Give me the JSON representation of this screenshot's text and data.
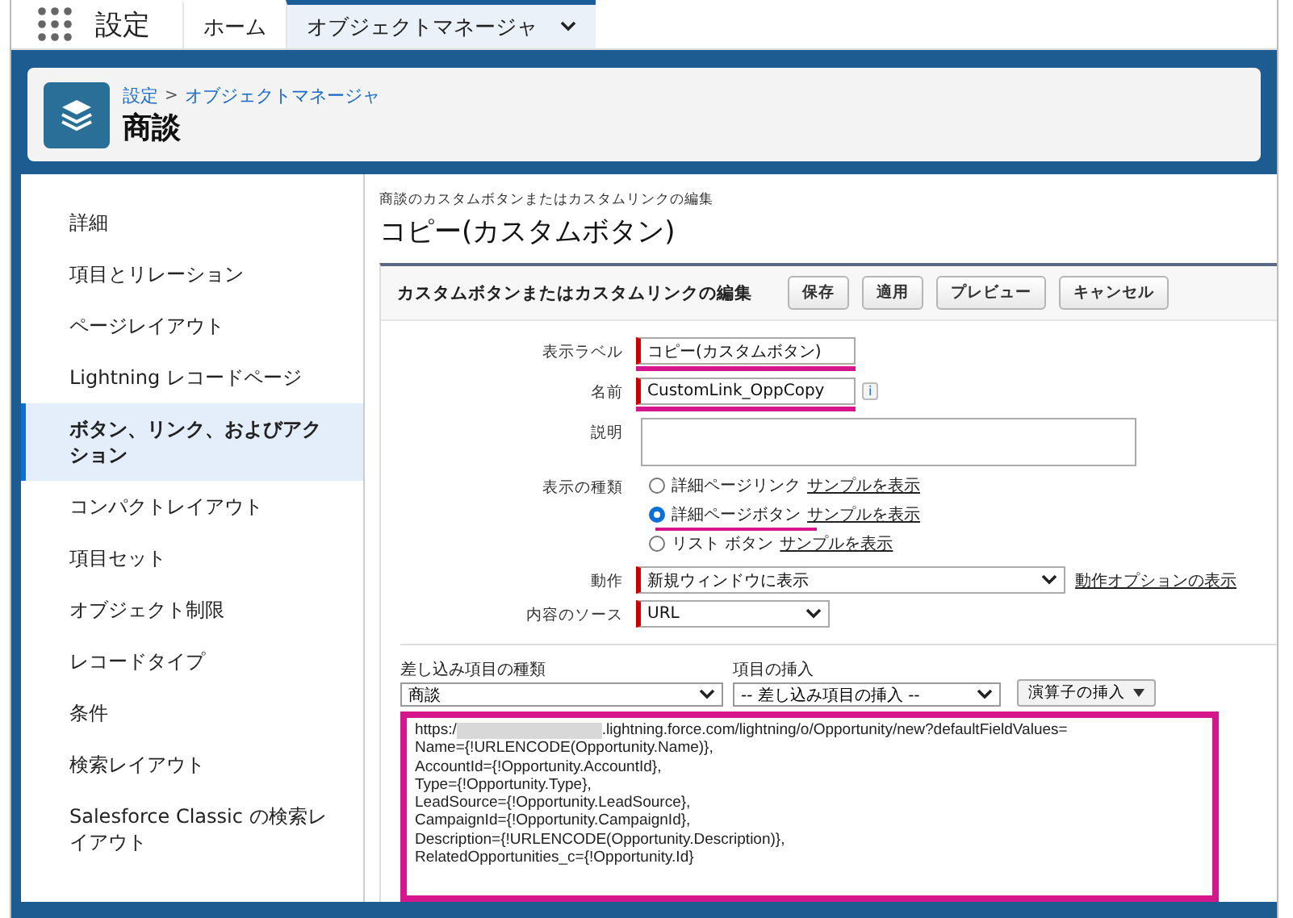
{
  "nav": {
    "app_title": "設定",
    "tabs": [
      {
        "label": "ホーム",
        "selected": false,
        "menu": false
      },
      {
        "label": "オブジェクトマネージャ",
        "selected": true,
        "menu": true
      }
    ]
  },
  "header": {
    "breadcrumb": [
      {
        "label": "設定"
      },
      {
        "label": "オブジェクトマネージャ"
      }
    ],
    "separator": ">",
    "title": "商談"
  },
  "sidebar": {
    "items": [
      {
        "label": "詳細",
        "selected": false
      },
      {
        "label": "項目とリレーション",
        "selected": false
      },
      {
        "label": "ページレイアウト",
        "selected": false
      },
      {
        "label": "Lightning レコードページ",
        "selected": false
      },
      {
        "label": "ボタン、リンク、およびアクション",
        "selected": true
      },
      {
        "label": "コンパクトレイアウト",
        "selected": false
      },
      {
        "label": "項目セット",
        "selected": false
      },
      {
        "label": "オブジェクト制限",
        "selected": false
      },
      {
        "label": "レコードタイプ",
        "selected": false
      },
      {
        "label": "条件",
        "selected": false
      },
      {
        "label": "検索レイアウト",
        "selected": false
      },
      {
        "label": "Salesforce Classic の検索レイアウト",
        "selected": false
      }
    ]
  },
  "page": {
    "subtitle": "商談のカスタムボタンまたはカスタムリンクの編集",
    "title": "コピー(カスタムボタン)"
  },
  "panel": {
    "title": "カスタムボタンまたはカスタムリンクの編集",
    "buttons": [
      "保存",
      "適用",
      "プレビュー",
      "キャンセル"
    ]
  },
  "form": [
    {
      "kind": "text",
      "label": "表示ラベル",
      "value": "コピー(カスタムボタン)",
      "required": true,
      "highlighted": true
    },
    {
      "kind": "text",
      "label": "名前",
      "value": "CustomLink_OppCopy",
      "required": true,
      "highlighted": true,
      "info": "i"
    },
    {
      "kind": "textarea",
      "label": "説明"
    },
    {
      "kind": "radio",
      "label": "表示の種類",
      "options": [
        {
          "label": "詳細ページリンク",
          "link": "サンプルを表示",
          "selected": false,
          "highlighted": false
        },
        {
          "label": "詳細ページボタン",
          "link": "サンプルを表示",
          "selected": true,
          "highlighted": true
        },
        {
          "label": "リスト ボタン",
          "link": "サンプルを表示",
          "selected": false,
          "highlighted": false
        }
      ]
    },
    {
      "kind": "select",
      "label": "動作",
      "value": "新規ウィンドウに表示",
      "required": true,
      "wide": true,
      "link": "動作オプションの表示"
    },
    {
      "kind": "select",
      "label": "内容のソース",
      "value": "URL",
      "required": true,
      "wide": false
    }
  ],
  "insert": {
    "field_type": {
      "label": "差し込み項目の種類",
      "value": "商談"
    },
    "field_insert": {
      "label": "項目の挿入",
      "value": "-- 差し込み項目の挿入 --"
    },
    "operator_button": "演算子の挿入"
  },
  "formula": {
    "highlighted": true,
    "prefix": "https:/",
    "redacted": true,
    "lines": [
      ".lightning.force.com/lightning/o/Opportunity/new?defaultFieldValues=",
      "Name={!URLENCODE(Opportunity.Name)},",
      "AccountId={!Opportunity.AccountId},",
      "Type={!Opportunity.Type},",
      "LeadSource={!Opportunity.LeadSource},",
      "CampaignId={!Opportunity.CampaignId},",
      "Description={!URLENCODE(Opportunity.Description)},",
      "RelatedOpportunities_c={!Opportunity.Id}"
    ]
  }
}
